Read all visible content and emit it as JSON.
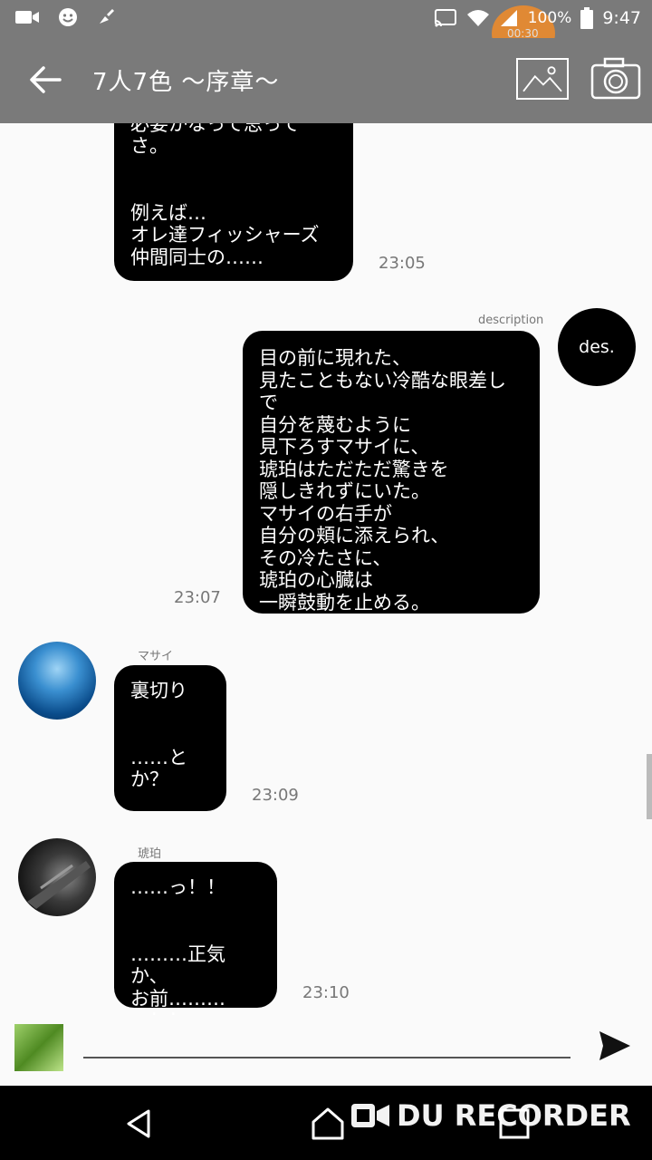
{
  "status_bar": {
    "battery": "100%",
    "time": "9:47",
    "recording_time": "00:30"
  },
  "app_bar": {
    "title": "7人7色 〜序章〜"
  },
  "messages": [
    {
      "text": "ことこうハーハール\n必要かなって思ってさ。\n\n\n例えば…\nオレ達フィッシャーズ\n仲間同士の……",
      "time": "23:05"
    },
    {
      "sender": "description",
      "avatar_label": "des.",
      "text": "目の前に現れた、\n見たこともない冷酷な眼差しで\n自分を蔑むように\n見下ろすマサイに、\n琥珀はただただ驚きを\n隠しきれずにいた。\nマサイの右手が\n自分の頬に添えられ、\nその冷たさに、\n琥珀の心臓は\n一瞬鼓動を止める。",
      "time": "23:07"
    },
    {
      "sender": "マサイ",
      "text": "裏切り\n\n\n……とか？",
      "time": "23:09"
    },
    {
      "sender": "琥珀",
      "text": "……っ！！\n\n\n………正気か、\nお前………っ！！",
      "time": "23:10"
    }
  ],
  "input": {
    "placeholder": ""
  },
  "watermark": "DU RECORDER",
  "colors": {
    "bar": "#7a7a7a",
    "bubble": "#000000",
    "background": "#fafafa",
    "recording_dot": "#f28c28"
  },
  "icons": [
    "back-arrow-icon",
    "image-icon",
    "camera-icon",
    "send-icon",
    "nav-back-icon",
    "nav-home-icon",
    "nav-recents-icon"
  ]
}
